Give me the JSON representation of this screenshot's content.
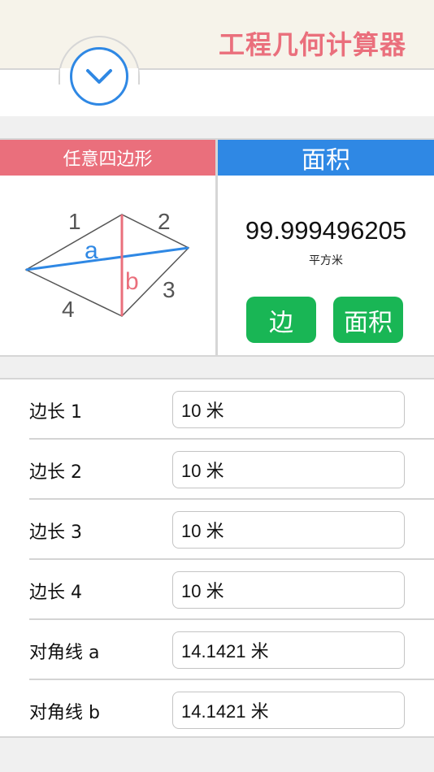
{
  "header": {
    "title": "工程几何计算器",
    "collapse_icon": "chevron-down-icon"
  },
  "shape": {
    "name": "任意四边形",
    "diagram": {
      "side_labels": [
        "1",
        "2",
        "3",
        "4"
      ],
      "diagonal_a_label": "a",
      "diagonal_b_label": "b"
    }
  },
  "result": {
    "title": "面积",
    "value": "99.999496205",
    "unit": "平方米"
  },
  "buttons": {
    "side_label": "边",
    "area_label": "面积"
  },
  "form": {
    "rows": [
      {
        "label": "边长 1",
        "value": "10 米"
      },
      {
        "label": "边长 2",
        "value": "10 米"
      },
      {
        "label": "边长 3",
        "value": "10 米"
      },
      {
        "label": "边长 4",
        "value": "10 米"
      },
      {
        "label": "对角线 a",
        "value": "14.1421 米"
      },
      {
        "label": "对角线 b",
        "value": "14.1421 米"
      }
    ]
  },
  "colors": {
    "accent_pink": "#ea6f7c",
    "accent_blue": "#2f88e4",
    "button_green": "#19b655",
    "header_bg": "#f6f3ea"
  }
}
